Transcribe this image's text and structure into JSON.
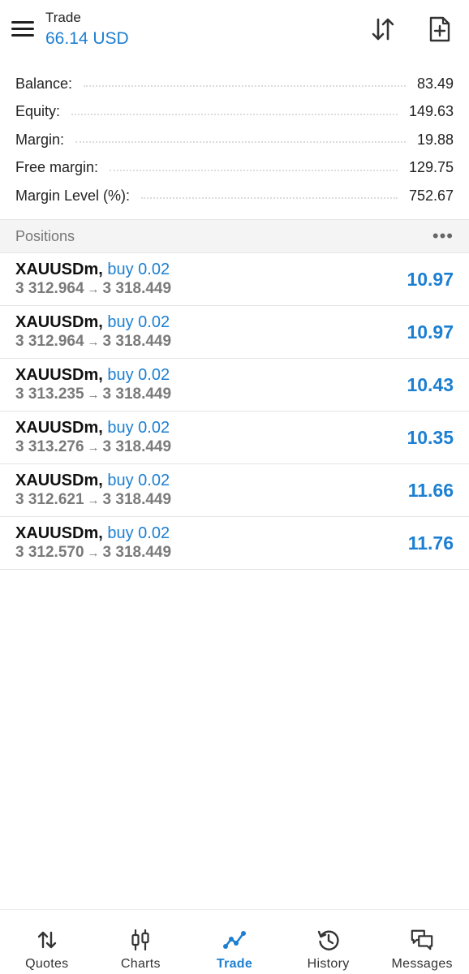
{
  "header": {
    "title": "Trade",
    "subtitle": "66.14 USD",
    "accent_color": "#1c7fd1",
    "icons": [
      "menu-icon",
      "sort-icon",
      "new-order-icon"
    ]
  },
  "summary": [
    {
      "label": "Balance:",
      "value": "83.49"
    },
    {
      "label": "Equity:",
      "value": "149.63"
    },
    {
      "label": "Margin:",
      "value": "19.88"
    },
    {
      "label": "Free margin:",
      "value": "129.75"
    },
    {
      "label": "Margin Level (%):",
      "value": "752.67"
    }
  ],
  "positions": {
    "title": "Positions",
    "more": "•••",
    "items": [
      {
        "symbol": "XAUUSDm,",
        "direction": "buy 0.02",
        "open": "3 312.964",
        "arrow": "→",
        "current": "3 318.449",
        "profit": "10.97"
      },
      {
        "symbol": "XAUUSDm,",
        "direction": "buy 0.02",
        "open": "3 312.964",
        "arrow": "→",
        "current": "3 318.449",
        "profit": "10.97"
      },
      {
        "symbol": "XAUUSDm,",
        "direction": "buy 0.02",
        "open": "3 313.235",
        "arrow": "→",
        "current": "3 318.449",
        "profit": "10.43"
      },
      {
        "symbol": "XAUUSDm,",
        "direction": "buy 0.02",
        "open": "3 313.276",
        "arrow": "→",
        "current": "3 318.449",
        "profit": "10.35"
      },
      {
        "symbol": "XAUUSDm,",
        "direction": "buy 0.02",
        "open": "3 312.621",
        "arrow": "→",
        "current": "3 318.449",
        "profit": "11.66"
      },
      {
        "symbol": "XAUUSDm,",
        "direction": "buy 0.02",
        "open": "3 312.570",
        "arrow": "→",
        "current": "3 318.449",
        "profit": "11.76"
      }
    ]
  },
  "nav": [
    {
      "label": "Quotes",
      "icon": "quotes-icon",
      "active": false
    },
    {
      "label": "Charts",
      "icon": "charts-icon",
      "active": false
    },
    {
      "label": "Trade",
      "icon": "trade-icon",
      "active": true
    },
    {
      "label": "History",
      "icon": "history-icon",
      "active": false
    },
    {
      "label": "Messages",
      "icon": "messages-icon",
      "active": false
    }
  ]
}
